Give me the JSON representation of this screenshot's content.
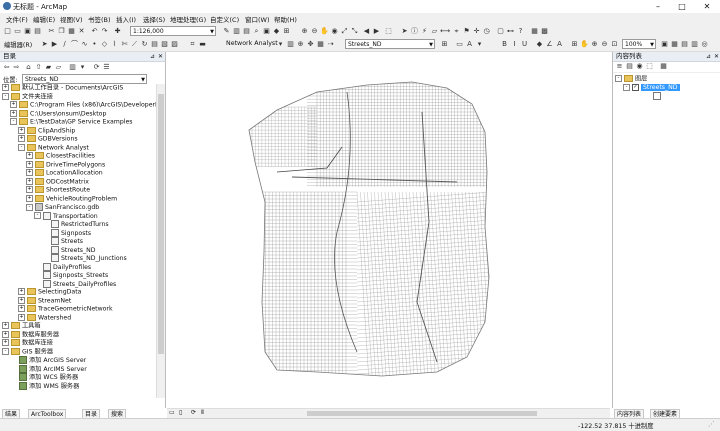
{
  "window": {
    "title": "无标题 - ArcMap"
  },
  "menus": [
    "文件(F)",
    "编辑(E)",
    "视图(V)",
    "书签(B)",
    "插入(I)",
    "选择(S)",
    "地理处理(G)",
    "自定义(C)",
    "窗口(W)",
    "帮助(H)"
  ],
  "toolbar": {
    "scale_value": "1:126,000",
    "editor_label": "编辑器(R)",
    "network_analyst_label": "Network Analyst",
    "network_dataset_value": "Streets_ND",
    "zoom_value": "100%"
  },
  "catalog": {
    "title": "目录",
    "location_label": "位置:",
    "location_value": "Streets_ND",
    "items": [
      {
        "label": "默认工作目录 - Documents\\ArcGIS",
        "level": 0,
        "exp": "+",
        "icon": "fold"
      },
      {
        "label": "文件夹连接",
        "level": 0,
        "exp": "-",
        "icon": "fold"
      },
      {
        "label": "C:\\Program Files (x86)\\ArcGIS\\DeveloperK",
        "level": 1,
        "exp": "+",
        "icon": "fold"
      },
      {
        "label": "C:\\Users\\onsum\\Desktop",
        "level": 1,
        "exp": "+",
        "icon": "fold"
      },
      {
        "label": "E:\\TestData\\GP Service Examples",
        "level": 1,
        "exp": "-",
        "icon": "fold"
      },
      {
        "label": "ClipAndShip",
        "level": 2,
        "exp": "+",
        "icon": "fold"
      },
      {
        "label": "GDBVersions",
        "level": 2,
        "exp": "+",
        "icon": "fold"
      },
      {
        "label": "Network Analyst",
        "level": 2,
        "exp": "-",
        "icon": "fold"
      },
      {
        "label": "ClosestFacilities",
        "level": 3,
        "exp": "+",
        "icon": "fold"
      },
      {
        "label": "DriveTimePolygons",
        "level": 3,
        "exp": "+",
        "icon": "fold"
      },
      {
        "label": "LocationAllocation",
        "level": 3,
        "exp": "+",
        "icon": "fold"
      },
      {
        "label": "ODCostMatrix",
        "level": 3,
        "exp": "+",
        "icon": "fold"
      },
      {
        "label": "ShortestRoute",
        "level": 3,
        "exp": "+",
        "icon": "fold"
      },
      {
        "label": "VehicleRoutingProblem",
        "level": 3,
        "exp": "+",
        "icon": "fold"
      },
      {
        "label": "SanFrancisco.gdb",
        "level": 3,
        "exp": "-",
        "icon": "gdb"
      },
      {
        "label": "Transportation",
        "level": 4,
        "exp": "-",
        "icon": "fc"
      },
      {
        "label": "RestrictedTurns",
        "level": 5,
        "exp": "",
        "icon": "fc"
      },
      {
        "label": "Signposts",
        "level": 5,
        "exp": "",
        "icon": "fc"
      },
      {
        "label": "Streets",
        "level": 5,
        "exp": "",
        "icon": "fc"
      },
      {
        "label": "Streets_ND",
        "level": 5,
        "exp": "",
        "icon": "fc"
      },
      {
        "label": "Streets_ND_Junctions",
        "level": 5,
        "exp": "",
        "icon": "fc"
      },
      {
        "label": "DailyProfiles",
        "level": 4,
        "exp": "",
        "icon": "fc"
      },
      {
        "label": "Signposts_Streets",
        "level": 4,
        "exp": "",
        "icon": "fc"
      },
      {
        "label": "Streets_DailyProfiles",
        "level": 4,
        "exp": "",
        "icon": "fc"
      },
      {
        "label": "SelectingData",
        "level": 2,
        "exp": "+",
        "icon": "fold"
      },
      {
        "label": "StreamNet",
        "level": 2,
        "exp": "+",
        "icon": "fold"
      },
      {
        "label": "TraceGeometricNetwork",
        "level": 2,
        "exp": "+",
        "icon": "fold"
      },
      {
        "label": "Watershed",
        "level": 2,
        "exp": "+",
        "icon": "fold"
      },
      {
        "label": "工具箱",
        "level": 0,
        "exp": "+",
        "icon": "fold"
      },
      {
        "label": "数据库服务器",
        "level": 0,
        "exp": "+",
        "icon": "fold"
      },
      {
        "label": "数据库连接",
        "level": 0,
        "exp": "+",
        "icon": "fold"
      },
      {
        "label": "GIS 服务器",
        "level": 0,
        "exp": "-",
        "icon": "fold"
      },
      {
        "label": "添加 ArcGIS Server",
        "level": 1,
        "exp": "",
        "icon": "srv"
      },
      {
        "label": "添加 ArcIMS Server",
        "level": 1,
        "exp": "",
        "icon": "srv"
      },
      {
        "label": "添加 WCS 服务器",
        "level": 1,
        "exp": "",
        "icon": "srv"
      },
      {
        "label": "添加 WMS 服务器",
        "level": 1,
        "exp": "",
        "icon": "srv"
      }
    ],
    "bottom_tabs": [
      "结果",
      "ArcToolbox",
      "目录",
      "搜索"
    ]
  },
  "toc": {
    "title": "内容列表",
    "layers_label": "图层",
    "layer_name": "Streets_ND",
    "bottom_tabs": [
      "内容列表",
      "创建要素"
    ]
  },
  "status": {
    "coordinates": "-122.52  37.815 十进制度"
  }
}
